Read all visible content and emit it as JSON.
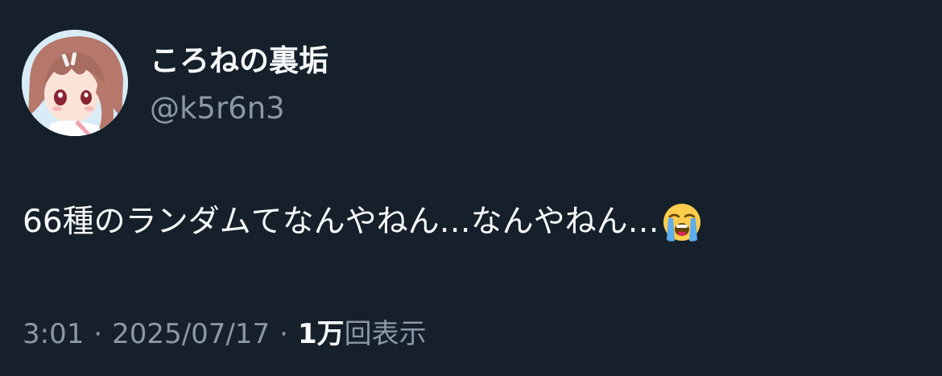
{
  "author": {
    "display_name": "ころねの裏垢",
    "handle": "@k5r6n3",
    "avatar_icon": "anime-girl-avatar"
  },
  "tweet": {
    "text": "66種のランダムてなんやねん…なんやねん…",
    "emoji": "loudly-crying-face-icon"
  },
  "meta": {
    "time": "3:01",
    "separator": "·",
    "date": "2025/07/17",
    "views_count": "1万",
    "views_label": "回表示"
  },
  "colors": {
    "background": "#15202b",
    "primary_text": "#f7f9f9",
    "secondary_text": "#8b98a5"
  }
}
